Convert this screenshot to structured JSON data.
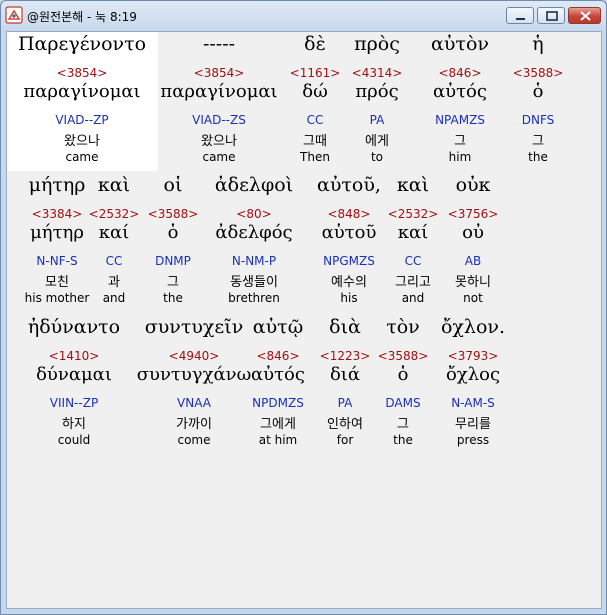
{
  "window": {
    "title": "@원전본해 - 눅 8:19"
  },
  "lines": [
    {
      "words": [
        {
          "greek": "Παρεγένοντο",
          "strong": "<3854>",
          "lemma": "παραγίνομαι",
          "parse": "VIAD--ZP",
          "korean": "왔으나",
          "english": "came"
        },
        {
          "greek": "-----",
          "strong": "<3854>",
          "lemma": "παραγίνομαι",
          "parse": "VIAD--ZS",
          "korean": "왔으나",
          "english": "came"
        },
        {
          "greek": "δὲ",
          "strong": "<1161>",
          "lemma": "δώ",
          "parse": "CC",
          "korean": "그때",
          "english": "Then"
        },
        {
          "greek": "πρὸς",
          "strong": "<4314>",
          "lemma": "πρός",
          "parse": "PA",
          "korean": "에게",
          "english": "to"
        },
        {
          "greek": "αὐτὸν",
          "strong": "<846>",
          "lemma": "αὐτός",
          "parse": "NPAMZS",
          "korean": "그",
          "english": "him"
        },
        {
          "greek": "ἡ",
          "strong": "<3588>",
          "lemma": "ὁ",
          "parse": "DNFS",
          "korean": "그",
          "english": "the"
        }
      ]
    },
    {
      "words": [
        {
          "greek": "μήτηρ",
          "strong": "<3384>",
          "lemma": "μήτηρ",
          "parse": "N-NF-S",
          "korean": "모친",
          "english": "his mother"
        },
        {
          "greek": "καὶ",
          "strong": "<2532>",
          "lemma": "καί",
          "parse": "CC",
          "korean": "과",
          "english": "and"
        },
        {
          "greek": "οἱ",
          "strong": "<3588>",
          "lemma": "ὁ",
          "parse": "DNMP",
          "korean": "그",
          "english": "the"
        },
        {
          "greek": "ἀδελφοὶ",
          "strong": "<80>",
          "lemma": "ἀδελφός",
          "parse": "N-NM-P",
          "korean": "동생들이",
          "english": "brethren"
        },
        {
          "greek": "αὐτοῦ,",
          "strong": "<848>",
          "lemma": "αὑτοῦ",
          "parse": "NPGMZS",
          "korean": "예수의",
          "english": "his"
        },
        {
          "greek": "καὶ",
          "strong": "<2532>",
          "lemma": "καί",
          "parse": "CC",
          "korean": "그리고",
          "english": "and"
        },
        {
          "greek": "οὐκ",
          "strong": "<3756>",
          "lemma": "οὐ",
          "parse": "AB",
          "korean": "못하니",
          "english": "not"
        }
      ]
    },
    {
      "words": [
        {
          "greek": "ἠδύναντο",
          "strong": "<1410>",
          "lemma": "δύναμαι",
          "parse": "VIIN--ZP",
          "korean": "하지",
          "english": "could"
        },
        {
          "greek": "συντυχεῖν",
          "strong": "<4940>",
          "lemma": "συντυγχάνω",
          "parse": "VNAA",
          "korean": "가까이",
          "english": "come"
        },
        {
          "greek": "αὐτῷ",
          "strong": "<846>",
          "lemma": "αὐτός",
          "parse": "NPDMZS",
          "korean": "그에게",
          "english": "at him"
        },
        {
          "greek": "διὰ",
          "strong": "<1223>",
          "lemma": "διά",
          "parse": "PA",
          "korean": "인하여",
          "english": "for"
        },
        {
          "greek": "τὸν",
          "strong": "<3588>",
          "lemma": "ὁ",
          "parse": "DAMS",
          "korean": "그",
          "english": "the"
        },
        {
          "greek": "ὄχλον.",
          "strong": "<3793>",
          "lemma": "ὄχλος",
          "parse": "N-AM-S",
          "korean": "무리를",
          "english": "press"
        }
      ]
    }
  ]
}
